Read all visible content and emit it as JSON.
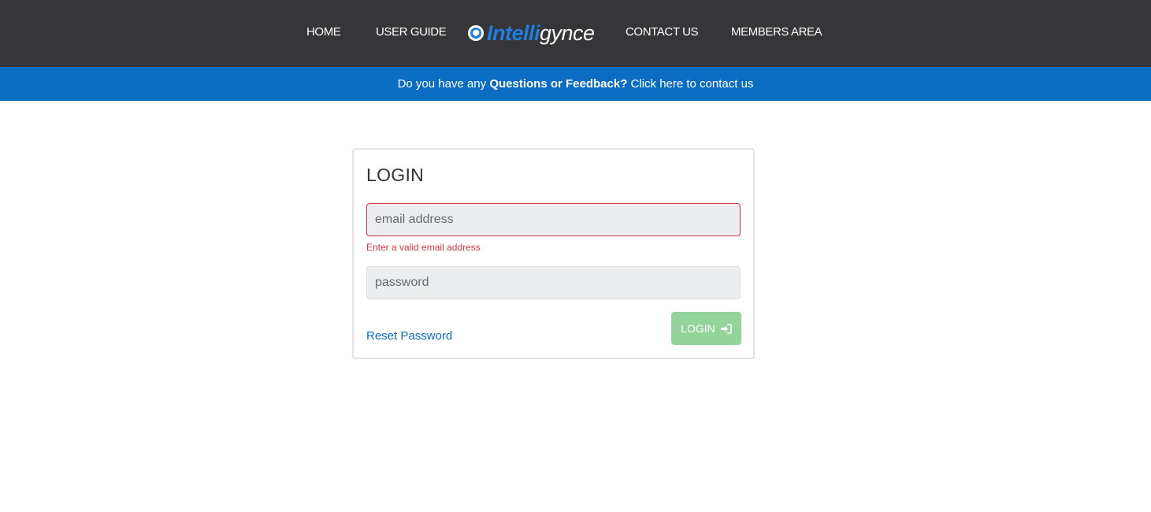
{
  "nav": {
    "home": "HOME",
    "user_guide": "USER GUIDE",
    "logo": {
      "bold": "Intelli",
      "light": "gynce",
      "icon": "brain-globe-icon"
    },
    "contact": "CONTACT US",
    "members": "MEMBERS AREA"
  },
  "banner": {
    "prefix": "Do you have any ",
    "emphasis": "Questions or Feedback?",
    "suffix": " Click here to contact us"
  },
  "login": {
    "title": "LOGIN",
    "email_placeholder": "email address",
    "email_error": "Enter a valid email address",
    "password_placeholder": "password",
    "reset_link": "Reset Password",
    "submit_label": "LOGIN",
    "submit_icon": "sign-in-icon"
  },
  "colors": {
    "nav_bg": "#363639",
    "banner_bg": "#0a6dc2",
    "brand_blue": "#1e7fe0",
    "error_red": "#dc3545",
    "button_green": "#93d49b"
  }
}
